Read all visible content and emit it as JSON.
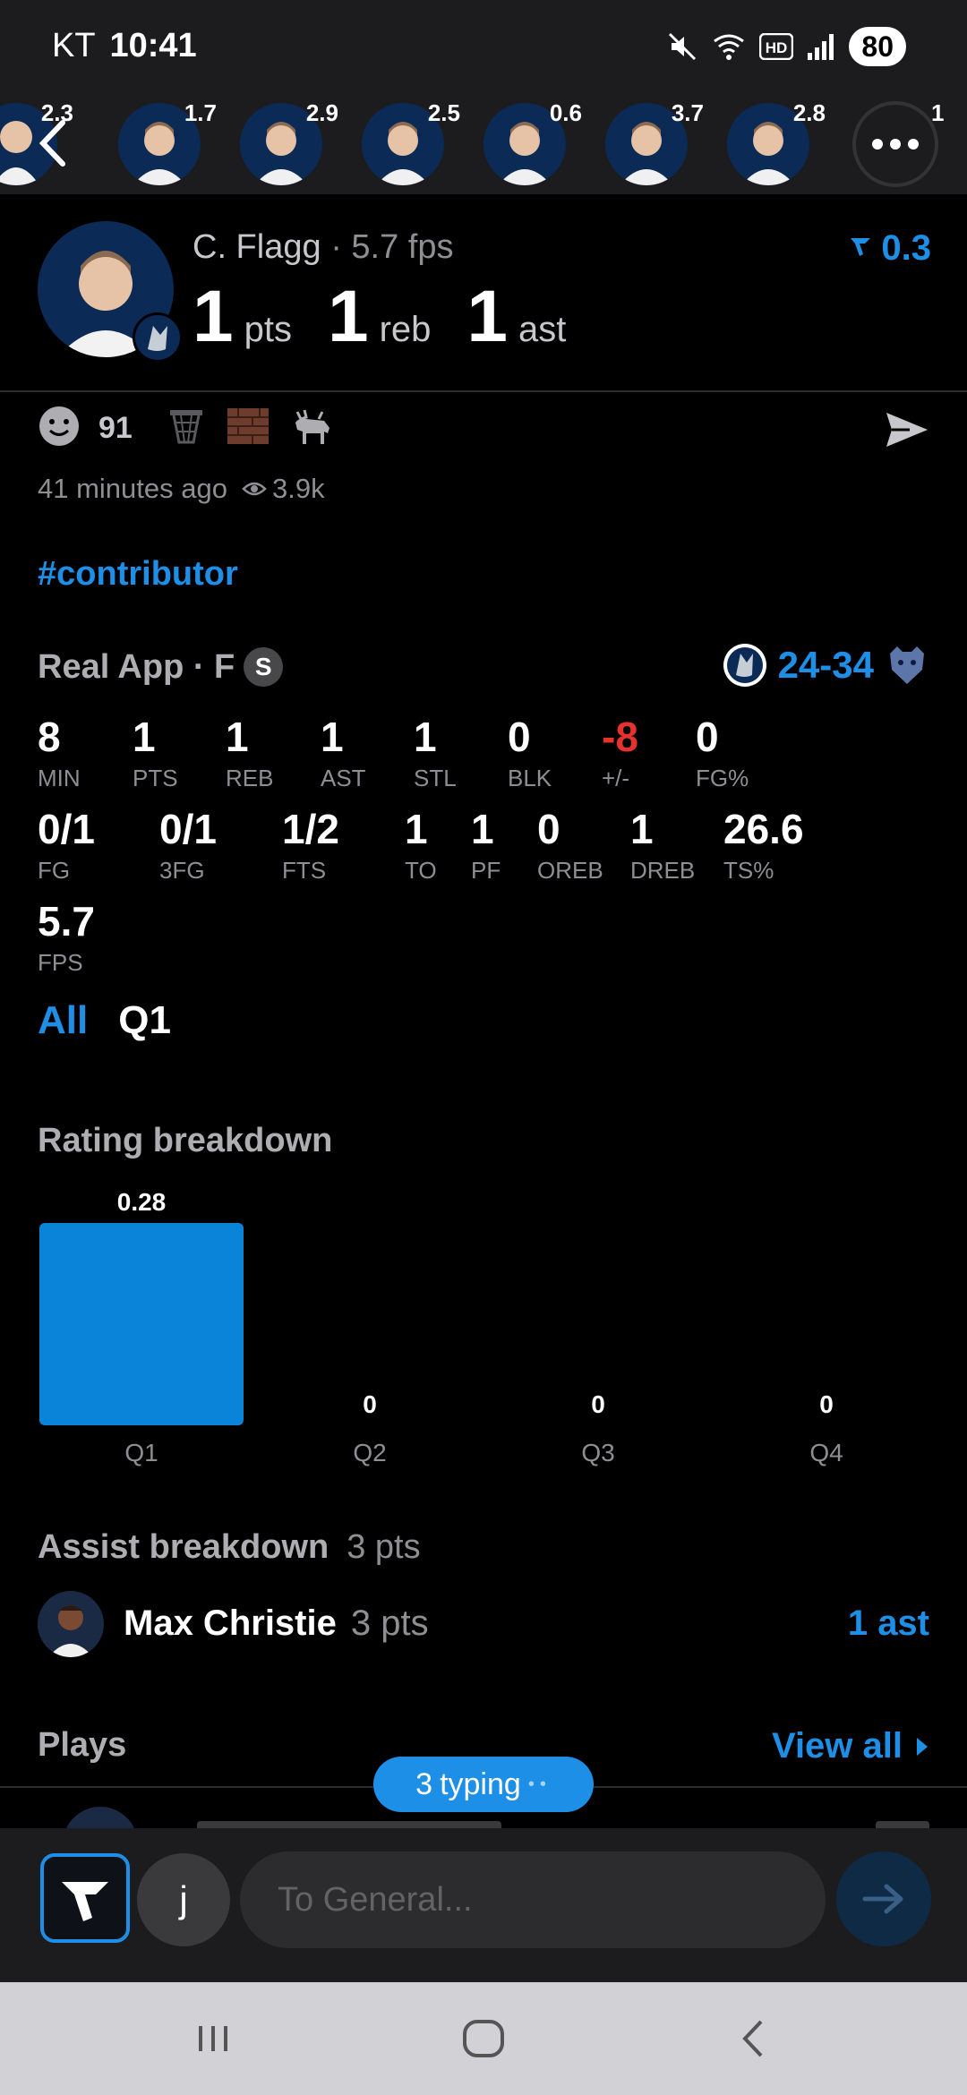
{
  "status_bar": {
    "carrier": "KT",
    "time": "10:41",
    "battery": "80"
  },
  "strip": {
    "scores": [
      "2.3",
      "1.7",
      "2.9",
      "2.5",
      "0.6",
      "3.7",
      "2.8",
      "1"
    ]
  },
  "player": {
    "name": "C. Flagg",
    "fps": "· 5.7 fps",
    "pts": "1",
    "pts_label": "pts",
    "reb": "1",
    "reb_label": "reb",
    "ast": "1",
    "ast_label": "ast",
    "delta": "0.3"
  },
  "reactions": {
    "count": "91"
  },
  "meta": {
    "time_ago": "41 minutes ago",
    "views": "3.9k"
  },
  "hashtag": "#contributor",
  "game": {
    "title": "Real App · F",
    "badge": "S",
    "score": "24-34"
  },
  "stats": {
    "row1": [
      {
        "v": "8",
        "k": "MIN"
      },
      {
        "v": "1",
        "k": "PTS"
      },
      {
        "v": "1",
        "k": "REB"
      },
      {
        "v": "1",
        "k": "AST"
      },
      {
        "v": "1",
        "k": "STL"
      },
      {
        "v": "0",
        "k": "BLK"
      },
      {
        "v": "-8",
        "k": "+/-"
      },
      {
        "v": "0",
        "k": "FG%"
      }
    ],
    "row2": [
      {
        "v": "0/1",
        "k": "FG"
      },
      {
        "v": "0/1",
        "k": "3FG"
      },
      {
        "v": "1/2",
        "k": "FTS"
      },
      {
        "v": "1",
        "k": "TO"
      },
      {
        "v": "1",
        "k": "PF"
      },
      {
        "v": "0",
        "k": "OREB"
      },
      {
        "v": "1",
        "k": "DREB"
      },
      {
        "v": "26.6",
        "k": "TS%"
      }
    ],
    "row3": [
      {
        "v": "5.7",
        "k": "FPS"
      }
    ]
  },
  "filters": {
    "all": "All",
    "q1": "Q1"
  },
  "rating": {
    "title": "Rating breakdown"
  },
  "chart_data": {
    "type": "bar",
    "categories": [
      "Q1",
      "Q2",
      "Q3",
      "Q4"
    ],
    "values": [
      0.28,
      0,
      0,
      0
    ],
    "value_labels": [
      "0.28",
      "0",
      "0",
      "0"
    ],
    "title": "Rating breakdown",
    "xlabel": "",
    "ylabel": "",
    "bar_color": "#0a84d8"
  },
  "assist": {
    "title": "Assist breakdown",
    "subtitle": "3 pts",
    "name": "Max Christie",
    "pts": "3 pts",
    "ast": "1 ast"
  },
  "plays": {
    "title": "Plays",
    "view_all": "View all"
  },
  "typing": {
    "count": "3",
    "text": "typing",
    "dots": "••"
  },
  "composer": {
    "user_initial": "j",
    "placeholder": "To General..."
  },
  "colors": {
    "accent": "#1e8fe6",
    "negative": "#e5322d",
    "bg": "#000000",
    "panel": "#1c1c1e"
  }
}
